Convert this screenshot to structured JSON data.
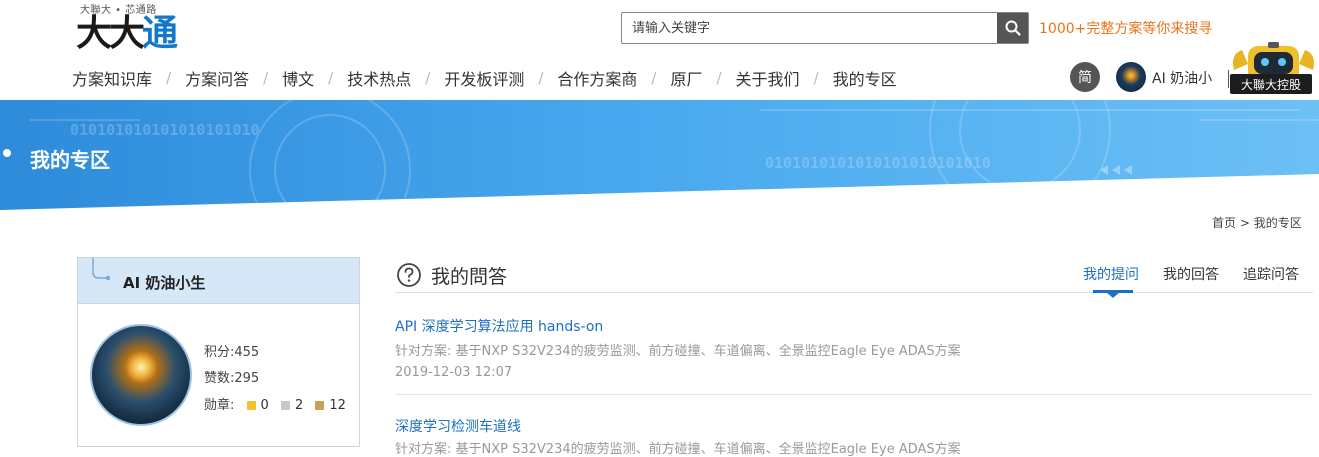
{
  "header": {
    "logo_tagline": "大聯大 • 芯通路",
    "logo_text_a": "大大",
    "logo_text_b": "通",
    "search_placeholder": "请输入关键字",
    "promo": "1000+完整方案等你来搜寻",
    "lang_button": "简",
    "user_name": "AI 奶油小生",
    "brand_tag": "大聯大控股"
  },
  "nav": {
    "items": [
      "方案知识库",
      "方案问答",
      "博文",
      "技术热点",
      "开发板评测",
      "合作方案商",
      "原厂",
      "关于我们",
      "我的专区"
    ]
  },
  "banner": {
    "title": "我的专区",
    "bits_1": "010101010101010101010",
    "bits_2": "0101010101010101010101010"
  },
  "breadcrumb": {
    "home": "首页",
    "separator": ">",
    "current": "我的专区"
  },
  "profile": {
    "name": "AI 奶油小生",
    "points_label": "积分:",
    "points": "455",
    "likes_label": "赞数:",
    "likes": "295",
    "medals_label": "勋章:",
    "medals": [
      {
        "color": "#f2c230",
        "count": "0"
      },
      {
        "color": "#c8c8c8",
        "count": "2"
      },
      {
        "color": "#c8a05a",
        "count": "12"
      }
    ]
  },
  "qa": {
    "title": "我的問答",
    "tabs": [
      "我的提问",
      "我的回答",
      "追踪问答"
    ],
    "active_tab": 0,
    "items": [
      {
        "title": "API 深度学习算法应用 hands-on",
        "meta": "针对方案: 基于NXP S32V234的疲劳监测、前方碰撞、车道偏离、全景监控Eagle Eye ADAS方案",
        "date": "2019-12-03 12:07"
      },
      {
        "title": "深度学习检测车道线",
        "meta": "针对方案: 基于NXP S32V234的疲劳监测、前方碰撞、车道偏离、全景监控Eagle Eye ADAS方案",
        "date": ""
      }
    ]
  },
  "colors": {
    "accent": "#1e6fc0",
    "promo": "#e8741c",
    "banner_light": "#6cc0f5",
    "banner_dark": "#2f8ad9"
  }
}
